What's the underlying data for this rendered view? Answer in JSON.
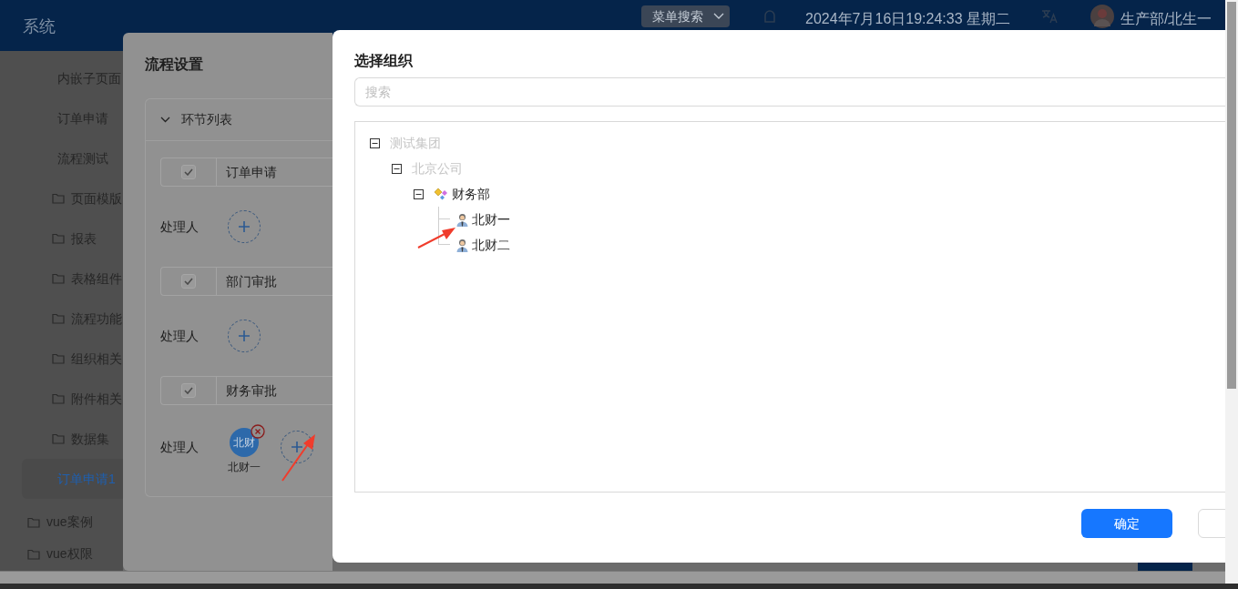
{
  "header": {
    "title": "系统",
    "menu_search": "菜单搜索",
    "datetime": "2024年7月16日19:24:33 星期二",
    "user": "生产部/北生一"
  },
  "sidebar": {
    "nested_items": [
      {
        "label": "内嵌子页面",
        "kind": "page",
        "selected": false
      },
      {
        "label": "订单申请",
        "kind": "page",
        "selected": false
      },
      {
        "label": "流程测试",
        "kind": "page",
        "selected": false
      },
      {
        "label": "页面模版",
        "kind": "folder",
        "selected": false
      },
      {
        "label": "报表",
        "kind": "folder",
        "selected": false
      },
      {
        "label": "表格组件",
        "kind": "folder",
        "selected": false
      },
      {
        "label": "流程功能",
        "kind": "folder",
        "selected": false
      },
      {
        "label": "组织相关",
        "kind": "folder",
        "selected": false
      },
      {
        "label": "附件相关",
        "kind": "folder",
        "selected": false
      },
      {
        "label": "数据集",
        "kind": "folder",
        "selected": false
      },
      {
        "label": "订单申请1",
        "kind": "page",
        "selected": true
      }
    ],
    "items": [
      {
        "label": "vue案例",
        "kind": "folder",
        "selected": false
      },
      {
        "label": "vue权限",
        "kind": "folder",
        "selected": false
      }
    ]
  },
  "process_dialog": {
    "title": "流程设置",
    "section": {
      "title": "环节列表",
      "expanded": true,
      "steps": [
        {
          "name": "订单申请",
          "checked": true,
          "handler_label": "处理人"
        },
        {
          "name": "部门审批",
          "checked": true,
          "handler_label": "处理人"
        },
        {
          "name": "财务审批",
          "checked": true,
          "handler_label": "处理人",
          "handlers": [
            {
              "avatar": "北财",
              "name": "北财一"
            }
          ]
        }
      ]
    }
  },
  "org_dialog": {
    "title": "选择组织",
    "search": {
      "placeholder": "搜索"
    },
    "tree": [
      {
        "label": "测试集团",
        "expanded": true,
        "disabled": true,
        "children": [
          {
            "label": "北京公司",
            "expanded": true,
            "disabled": true,
            "children": [
              {
                "label": "财务部",
                "kind": "dept",
                "expanded": true,
                "disabled": false,
                "children": [
                  {
                    "label": "北财一",
                    "kind": "person",
                    "disabled": false
                  },
                  {
                    "label": "北财二",
                    "kind": "person",
                    "disabled": false
                  }
                ]
              }
            ]
          }
        ]
      }
    ],
    "buttons": [
      {
        "label": "确定",
        "kind": "primary"
      },
      {
        "kind": "default"
      }
    ]
  }
}
